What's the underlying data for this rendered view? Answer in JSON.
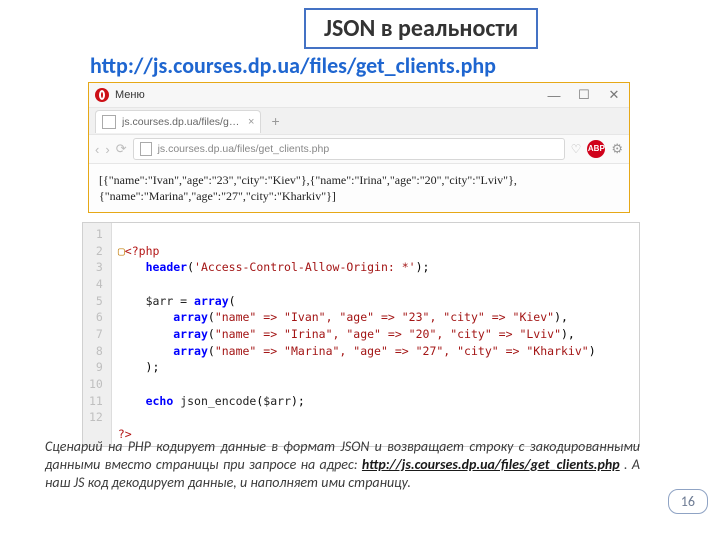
{
  "title": "JSON в реальности",
  "url_display": "http://js.courses.dp.ua/files/get_clients.php",
  "browser": {
    "menu_label": "Меню",
    "tab_title": "js.courses.dp.ua/files/get_...",
    "address": "js.courses.dp.ua/files/get_clients.php",
    "window_minimize": "—",
    "window_maximize": "☐",
    "window_close": "✕",
    "tab_close": "×",
    "plus_tab": "+",
    "nav_back": "‹",
    "nav_forward": "›",
    "reload": "⟳",
    "heart": "♡",
    "abp": "ABP",
    "gear": "⚙",
    "page_text": "[{\"name\":\"Ivan\",\"age\":\"23\",\"city\":\"Kiev\"},{\"name\":\"Irina\",\"age\":\"20\",\"city\":\"Lviv\"},{\"name\":\"Marina\",\"age\":\"27\",\"city\":\"Kharkiv\"}]"
  },
  "code": {
    "line_numbers": [
      "1",
      "2",
      "3",
      "4",
      "5",
      "6",
      "7",
      "8",
      "9",
      "10",
      "11",
      "12"
    ],
    "php_open": "<?php",
    "header_fn": "header",
    "header_arg": "'Access-Control-Allow-Origin: *'",
    "arr_assign": "$arr = ",
    "array_kw": "array",
    "row1": "\"name\" => \"Ivan\", \"age\" => \"23\", \"city\" => \"Kiev\"",
    "row2": "\"name\" => \"Irina\", \"age\" => \"20\", \"city\" => \"Lviv\"",
    "row3": "\"name\" => \"Marina\", \"age\" => \"27\", \"city\" => \"Kharkiv\"",
    "echo_kw": "echo",
    "json_enc": " json_encode",
    "arr_ref": "$arr",
    "php_close": "?>"
  },
  "caption": {
    "text_a": "Сценарий на PHP кодирует данные в формат JSON и возвращает  строку с закодированными данными вместо страницы при запросе на адрес: ",
    "link": "http://js.courses.dp.ua/files/get_clients.php",
    "text_b": " . А наш JS код декодирует данные, и наполняет ими страницу."
  },
  "page_number": "16"
}
